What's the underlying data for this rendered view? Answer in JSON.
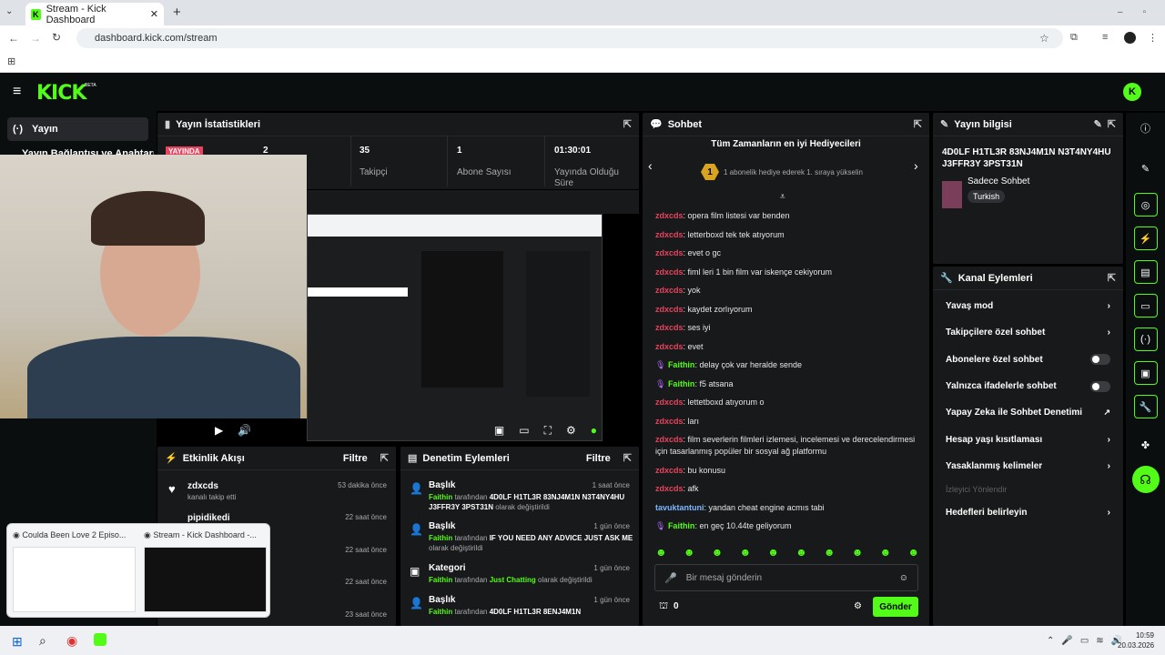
{
  "browser": {
    "tab_title": "Stream - Kick Dashboard",
    "url": "dashboard.kick.com/stream",
    "new_tab": "+"
  },
  "app": {
    "logo": "KICK",
    "beta": "BETA"
  },
  "sidebar": {
    "active": "Yayın",
    "item2": "Yayın Bağlantısı ve Anahtarı"
  },
  "stats": {
    "title": "Yayın İstatistikleri",
    "live_badge": "YAYINDA",
    "viewers": "2",
    "followers_value": "35",
    "followers_label": "Takipçi",
    "subs_value": "1",
    "subs_label": "Abone Sayısı",
    "duration_value": "01:30:01",
    "duration_label": "Yayında Olduğu Süre"
  },
  "chat": {
    "title": "Sohbet",
    "gifters_title": "Tüm Zamanların en iyi Hediyecileri",
    "gifters_rank": "1",
    "gifters_text": "1 abonelik hediye ederek 1. sıraya yükselin",
    "messages": [
      {
        "user": "zdxcds",
        "text": ": opera film listesi var benden",
        "color": "red"
      },
      {
        "user": "zdxcds",
        "text": ": letterboxd tek tek atıyorum",
        "color": "red"
      },
      {
        "user": "zdxcds",
        "text": ": evet o gc",
        "color": "red"
      },
      {
        "user": "zdxcds",
        "text": ": fiml leri 1 bin film var iskençe cekiyorum",
        "color": "red"
      },
      {
        "user": "zdxcds",
        "text": ": yok",
        "color": "red"
      },
      {
        "user": "zdxcds",
        "text": ": kaydet zorlıyorum",
        "color": "red"
      },
      {
        "user": "zdxcds",
        "text": ": ses iyi",
        "color": "red"
      },
      {
        "user": "zdxcds",
        "text": ": evet",
        "color": "red"
      },
      {
        "user": "Faithin",
        "text": ": delay çok var heralde sende",
        "color": "green"
      },
      {
        "user": "Faithin",
        "text": ": f5 atsana",
        "color": "green"
      },
      {
        "user": "zdxcds",
        "text": ": lettetboxd atıyorum o",
        "color": "red"
      },
      {
        "user": "zdxcds",
        "text": ": ları",
        "color": "red"
      },
      {
        "user": "zdxcds",
        "text": ": film severlerin filmleri izlemesi, incelemesi ve derecelendirmesi için tasarlanmış popüler bir sosyal ağ platformu",
        "color": "red"
      },
      {
        "user": "zdxcds",
        "text": ": bu konusu",
        "color": "red"
      },
      {
        "user": "zdxcds",
        "text": ": afk",
        "color": "red"
      },
      {
        "user": "tavuktantuni",
        "text": ": yandan cheat engine acmıs tabi",
        "color": "blue"
      },
      {
        "user": "Faithin",
        "text": ": en geç 10.44te geliyorum",
        "color": "green"
      }
    ],
    "input_placeholder": "Bir mesaj gönderin",
    "points": "0",
    "send": "Gönder"
  },
  "info": {
    "title": "Yayın bilgisi",
    "stream_title": "4D0LF H1TL3R 83NJ4M1N N3T4NY4HU J3FFR3Y 3PST31N",
    "category": "Sadece Sohbet",
    "language": "Turkish"
  },
  "channel": {
    "title": "Kanal Eylemleri",
    "rows": [
      "Yavaş mod",
      "Takipçilere özel sohbet",
      "Abonelere özel sohbet",
      "Yalnızca ifadelerle sohbet",
      "Yapay Zeka ile Sohbet Denetimi",
      "Hesap yaşı kısıtlaması",
      "Yasaklanmış kelimeler"
    ],
    "viewer_redirect": "İzleyici Yönlendir",
    "set_targets": "Hedefleri belirleyin"
  },
  "activity": {
    "title": "Etkinlik Akışı",
    "filter": "Filtre",
    "rows": [
      {
        "user": "zdxcds",
        "sub": "kanalı takip etti",
        "time": "53 dakika önce"
      },
      {
        "user": "pipidikedi",
        "sub": "",
        "time": "22 saat önce"
      },
      {
        "user": "",
        "sub": "",
        "time": "22 saat önce"
      },
      {
        "user": "",
        "sub": "",
        "time": "22 saat önce"
      },
      {
        "user": "",
        "sub": "",
        "time": "23 saat önce"
      }
    ]
  },
  "modlog": {
    "title": "Denetim Eylemleri",
    "filter": "Filtre",
    "rows": [
      {
        "type": "Başlık",
        "time": "1 saat önce",
        "actor": "Faithin",
        "by": " tarafından ",
        "value": "4D0LF H1TL3R 83NJ4M1N N3T4NY4HU J3FFR3Y 3PST31N",
        "suffix": " olarak değiştirildi"
      },
      {
        "type": "Başlık",
        "time": "1 gün önce",
        "actor": "Faithin",
        "by": " tarafından ",
        "value": "IF YOU NEED ANY ADVICE JUST ASK ME",
        "suffix": " olarak değiştirildi"
      },
      {
        "type": "Kategori",
        "time": "1 gün önce",
        "actor": "Faithin",
        "by": " tarafından ",
        "value": "Just Chatting",
        "suffix": " olarak değiştirildi"
      },
      {
        "type": "Başlık",
        "time": "1 gün önce",
        "actor": "Faithin",
        "by": " tarafından ",
        "value": "4D0LF H1TL3R 8ENJ4M1N",
        "suffix": ""
      }
    ]
  },
  "popup": {
    "item1": "Coulda Been Love 2 Episo...",
    "item2": "Stream - Kick Dashboard -..."
  },
  "taskbar": {
    "time": "10:59",
    "date": "20.03.2026"
  }
}
